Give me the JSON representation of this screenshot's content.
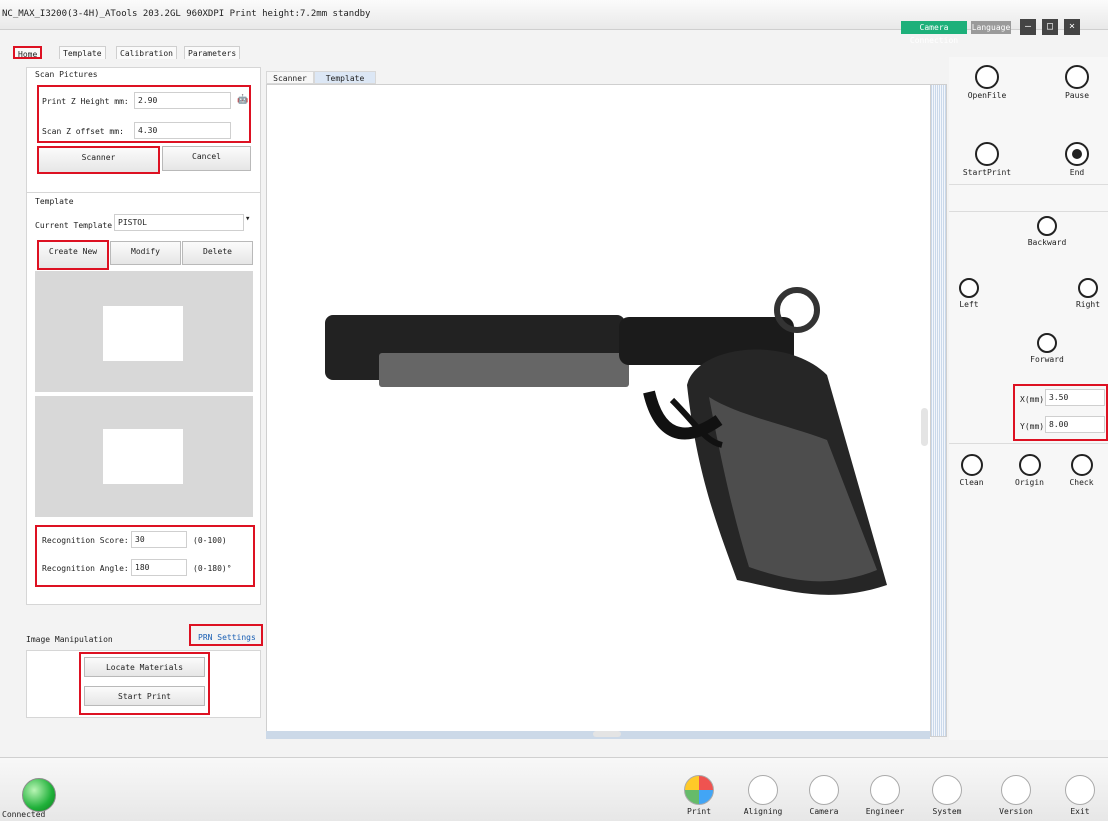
{
  "window": {
    "title": "NC_MAX_I3200(3-4H)_ATools 203.2GL 960XDPI Print height:7.2mm standby",
    "camera_connection": "Camera Connection",
    "language": "Language"
  },
  "tabs": [
    "Home",
    "Template",
    "Calibration",
    "Parameters"
  ],
  "scan": {
    "title": "Scan Pictures",
    "print_z_label": "Print Z Height mm:",
    "print_z_value": "2.90",
    "scan_z_label": "Scan Z offset mm:",
    "scan_z_value": "4.30",
    "scanner": "Scanner",
    "cancel": "Cancel"
  },
  "template": {
    "title": "Template",
    "current_label": "Current Template:",
    "current_value": "PISTOL",
    "create_new": "Create New",
    "modify": "Modify",
    "delete": "Delete",
    "score_label": "Recognition Score:",
    "score_value": "30",
    "score_range": "(0-100)",
    "angle_label": "Recognition Angle:",
    "angle_value": "180",
    "angle_range": "(0-180)°"
  },
  "image_manip": {
    "title": "Image Manipulation",
    "prn_settings": "PRN Settings",
    "locate_materials": "Locate Materials",
    "start_print": "Start Print"
  },
  "view_tabs": [
    "Scanner",
    "Template"
  ],
  "right": {
    "open_file": "OpenFile",
    "pause": "Pause",
    "start_print": "StartPrint",
    "end": "End",
    "backward": "Backward",
    "left": "Left",
    "right": "Right",
    "forward": "Forward",
    "x_label": "X(mm)",
    "x_value": "3.50",
    "y_label": "Y(mm)",
    "y_value": "8.00",
    "clean": "Clean",
    "origin": "Origin",
    "check": "Check"
  },
  "bottom": {
    "connected": "Connected",
    "items": [
      "Print",
      "Aligning",
      "Camera",
      "Engineer",
      "System",
      "Version",
      "Exit"
    ]
  }
}
